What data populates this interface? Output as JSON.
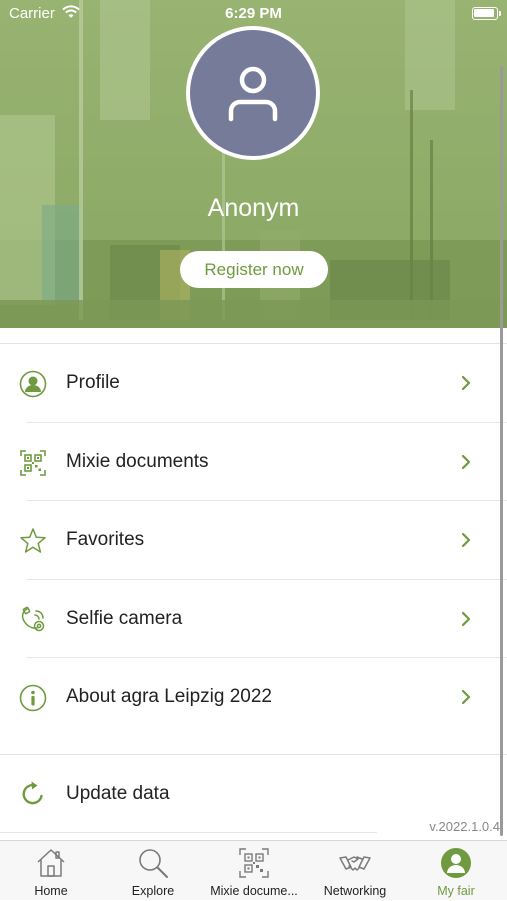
{
  "status_bar": {
    "carrier": "Carrier",
    "time": "6:29 PM"
  },
  "profile": {
    "name": "Anonym",
    "register_label": "Register now"
  },
  "menu": {
    "items": [
      {
        "label": "Profile",
        "icon": "person-circle-icon"
      },
      {
        "label": "Mixie documents",
        "icon": "qr-code-icon"
      },
      {
        "label": "Favorites",
        "icon": "star-icon"
      },
      {
        "label": "Selfie camera",
        "icon": "selfie-camera-icon"
      },
      {
        "label": "About agra Leipzig 2022",
        "icon": "info-icon"
      }
    ],
    "update_label": "Update data"
  },
  "version": "v.2022.1.0.4",
  "tabs": [
    {
      "label": "Home",
      "icon": "home-icon"
    },
    {
      "label": "Explore",
      "icon": "search-icon"
    },
    {
      "label": "Mixie docume...",
      "icon": "qr-code-icon"
    },
    {
      "label": "Networking",
      "icon": "handshake-icon"
    },
    {
      "label": "My fair",
      "icon": "person-icon",
      "active": true
    }
  ],
  "colors": {
    "accent": "#6f9a3f",
    "avatar": "#767b9a",
    "header_tint": "#9db57a"
  }
}
